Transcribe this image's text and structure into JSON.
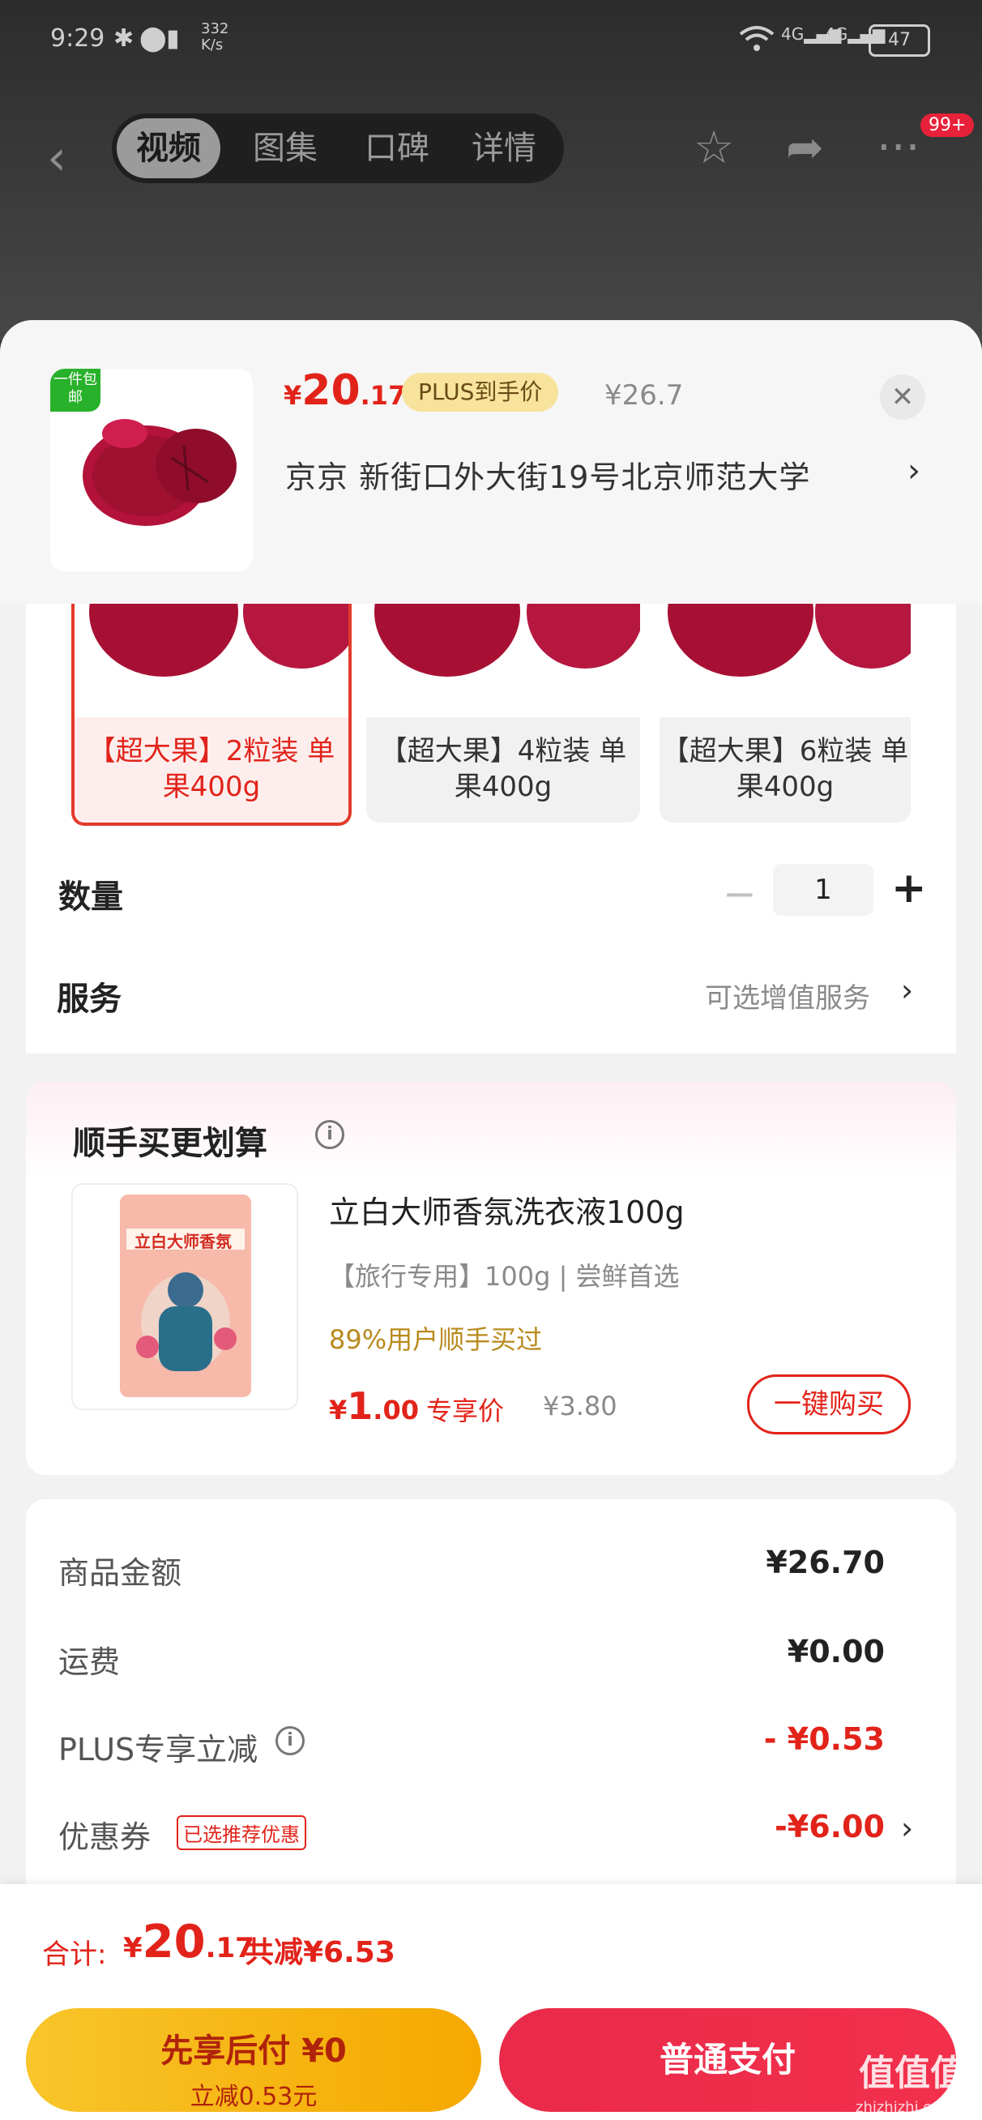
{
  "status_bar": {
    "time": "9:29",
    "net_speed_top": "332",
    "net_speed_unit": "K/s",
    "battery": "47"
  },
  "top_nav": {
    "tabs": [
      "视频",
      "图集",
      "口碑",
      "详情"
    ],
    "active_tab": "视频",
    "badge": "99+"
  },
  "product": {
    "price_symbol": "¥",
    "price_int": "20",
    "price_dec": ".17",
    "plus_tag": "PLUS到手价",
    "orig_price": "¥26.7",
    "free_tag": "一件包邮",
    "address": "京京   新街口外大街19号北京师范大学",
    "chevron": "›"
  },
  "specs": [
    {
      "label": "【超大果】2粒装 单果400g",
      "selected": true
    },
    {
      "label": "【超大果】4粒装 单果400g",
      "selected": false
    },
    {
      "label": "【超大果】6粒装 单果400g",
      "selected": false
    }
  ],
  "quantity": {
    "label": "数量",
    "value": "1",
    "minus": "−",
    "plus": "+"
  },
  "service": {
    "label": "服务",
    "value": "可选增值服务"
  },
  "recommend": {
    "title": "顺手买更划算",
    "info": "i",
    "name": "立白大师香氛洗衣液100g",
    "sub": "【旅行专用】100g | 尝鲜首选",
    "percent": "89%用户顺手买过",
    "price_symbol": "¥",
    "price_int": "1",
    "price_dec": ".00",
    "price_label": "专享价",
    "orig_price": "¥3.80",
    "buy_button": "一键购买",
    "package_brand": "立白大师香氛"
  },
  "breakdown": [
    {
      "label": "商品金额",
      "value": "¥26.70",
      "color": "#222222"
    },
    {
      "label": "运费",
      "value": "¥0.00",
      "color": "#222222"
    },
    {
      "label": "PLUS专享立减",
      "value": "- ¥0.53",
      "color": "#e2231a"
    },
    {
      "label": "优惠券",
      "value": "-¥6.00",
      "color": "#e2231a"
    }
  ],
  "coupon_tag": "已选推荐优惠",
  "footer": {
    "total_label": "合计:",
    "total_symbol": "¥",
    "total_int": "20",
    "total_dec": ".17",
    "total_save": "共减¥6.53",
    "later_title": "先享后付 ¥0",
    "later_sub": "立减0.53元",
    "pay_button": "普通支付"
  },
  "watermark": {
    "logo": "值值值",
    "site": "zhizhizhi.com"
  },
  "colors": {
    "accent": "#e2231a",
    "plus_gold": "#f7e39c",
    "pay_red": "#ee2c4b",
    "later_yellow": "#f7b918"
  }
}
